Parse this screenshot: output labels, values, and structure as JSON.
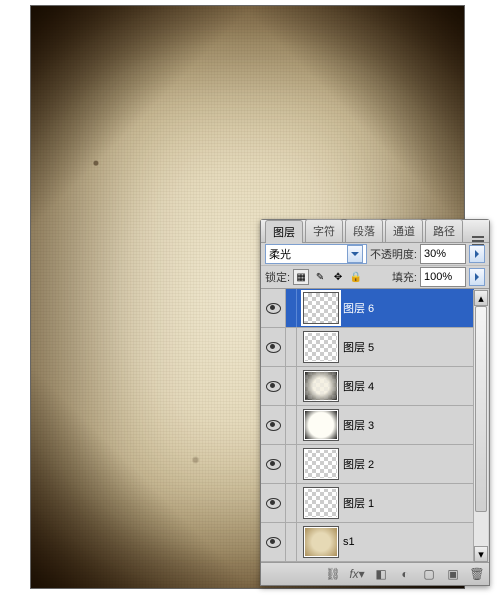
{
  "tabs": {
    "items": [
      "图层",
      "字符",
      "段落",
      "通道",
      "路径"
    ],
    "active_index": 0
  },
  "blend_row": {
    "mode": "柔光",
    "opacity_label": "不透明度:",
    "opacity_value": "30%"
  },
  "lock_row": {
    "label": "锁定:",
    "fill_label": "填充:",
    "fill_value": "100%",
    "icons": [
      "checker",
      "brush",
      "move",
      "lock"
    ]
  },
  "layers": [
    {
      "name": "图层 6",
      "thumb": "checker",
      "selected": true
    },
    {
      "name": "图层 5",
      "thumb": "checker",
      "selected": false
    },
    {
      "name": "图层 4",
      "thumb": "darkedges",
      "selected": false
    },
    {
      "name": "图层 3",
      "thumb": "darkedges2",
      "selected": false
    },
    {
      "name": "图层 2",
      "thumb": "checker",
      "selected": false
    },
    {
      "name": "图层 1",
      "thumb": "checker",
      "selected": false
    },
    {
      "name": "s1",
      "thumb": "paper-th",
      "selected": false
    }
  ],
  "bottom_icons": [
    "link",
    "fx",
    "mask",
    "adjust",
    "folder",
    "new",
    "trash"
  ]
}
